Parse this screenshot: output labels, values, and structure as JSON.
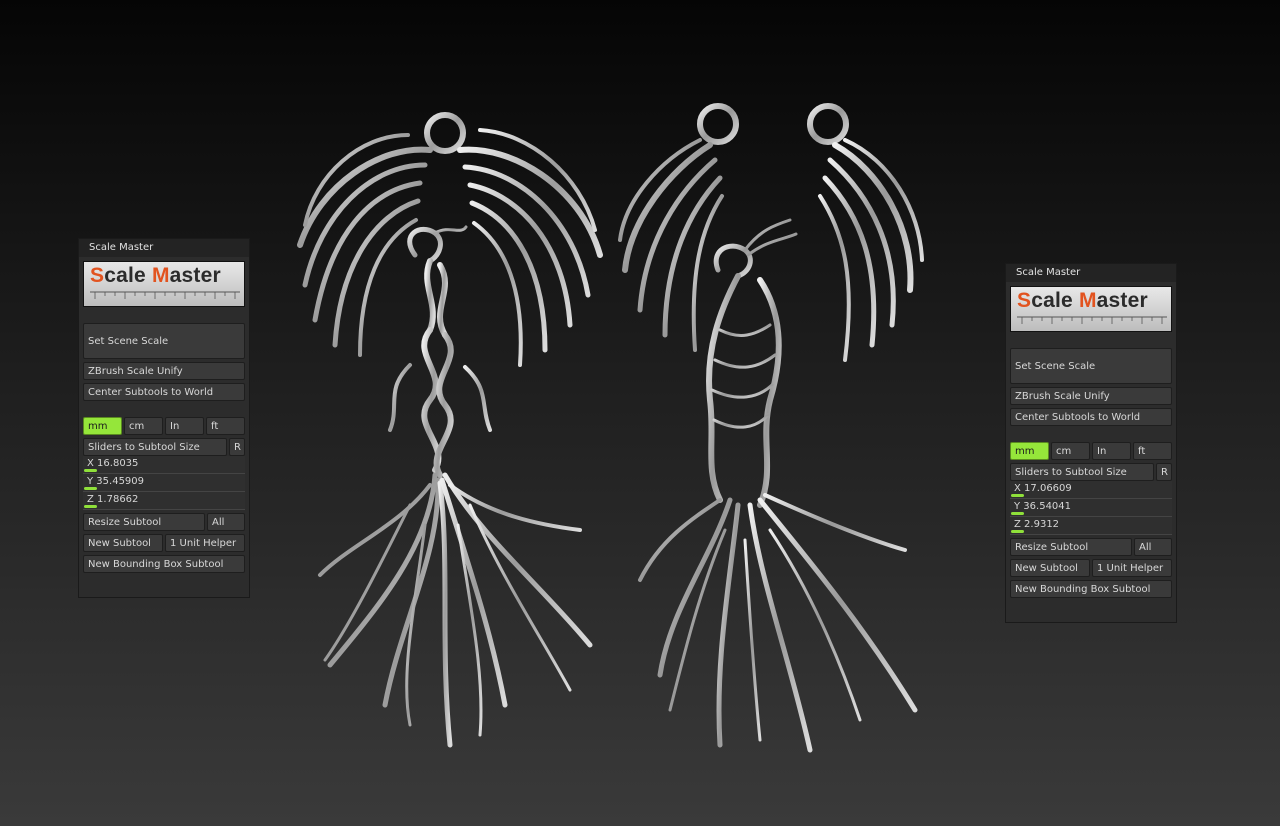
{
  "panels": [
    {
      "title": "Scale Master",
      "logo": {
        "first_cap": "S",
        "first_rest": "cale ",
        "second_cap": "M",
        "second_rest": "aster"
      },
      "set_scene_scale": "Set Scene Scale",
      "zbrush_scale_unify": "ZBrush Scale Unify",
      "center_subtools": "Center Subtools to World",
      "units": {
        "mm": "mm",
        "cm": "cm",
        "in": "In",
        "ft": "ft",
        "active": "mm"
      },
      "sliders_to_subtool": "Sliders to Subtool Size",
      "reset": "R",
      "x": {
        "axis": "X",
        "value": "16.8035"
      },
      "y": {
        "axis": "Y",
        "value": "35.45909"
      },
      "z": {
        "axis": "Z",
        "value": "1.78662"
      },
      "resize_subtool": "Resize Subtool",
      "all": "All",
      "new_subtool": "New Subtool",
      "unit_helper": "1 Unit Helper",
      "new_bbox": "New Bounding Box Subtool"
    },
    {
      "title": "Scale Master",
      "logo": {
        "first_cap": "S",
        "first_rest": "cale ",
        "second_cap": "M",
        "second_rest": "aster"
      },
      "set_scene_scale": "Set Scene Scale",
      "zbrush_scale_unify": "ZBrush Scale Unify",
      "center_subtools": "Center Subtools to World",
      "units": {
        "mm": "mm",
        "cm": "cm",
        "in": "In",
        "ft": "ft",
        "active": "mm"
      },
      "sliders_to_subtool": "Sliders to Subtool Size",
      "reset": "R",
      "x": {
        "axis": "X",
        "value": "17.06609"
      },
      "y": {
        "axis": "Y",
        "value": "36.54041"
      },
      "z": {
        "axis": "Z",
        "value": "2.9312"
      },
      "resize_subtool": "Resize Subtool",
      "all": "All",
      "new_subtool": "New Subtool",
      "unit_helper": "1 Unit Helper",
      "new_bbox": "New Bounding Box Subtool"
    }
  ],
  "colors": {
    "accent_green": "#95e63a",
    "logo_orange": "#e2531f",
    "metal": "#c8c8c8"
  },
  "models": [
    "phoenix-pendant-left",
    "phoenix-pendant-right"
  ]
}
